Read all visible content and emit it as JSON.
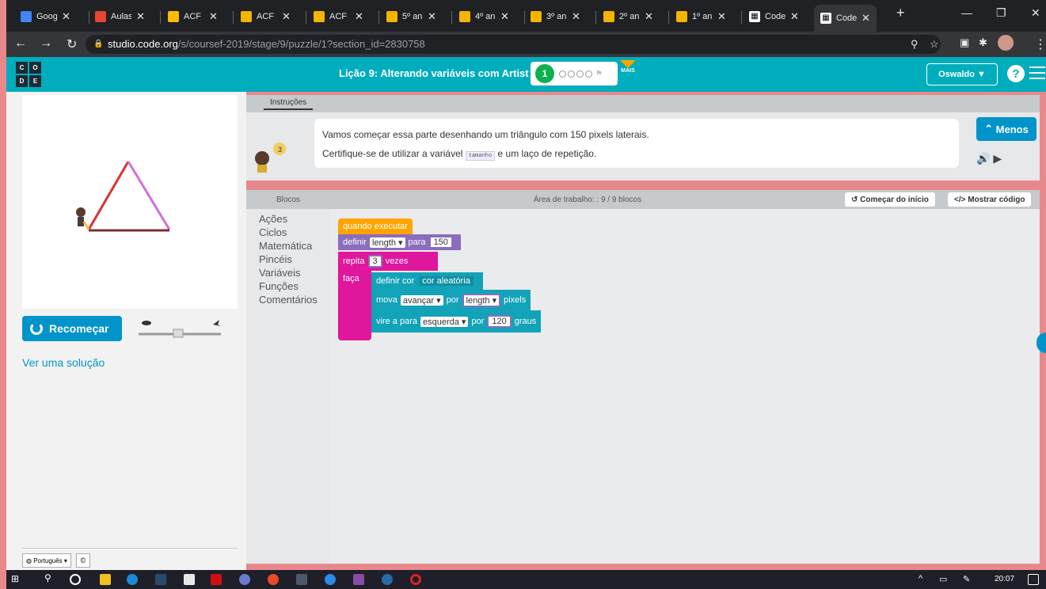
{
  "browser": {
    "tabs": [
      {
        "label": "Goog",
        "icon": "calendar-icon",
        "color": "#4285f4"
      },
      {
        "label": "Aulas",
        "icon": "gmail-icon",
        "color": "#ea4335"
      },
      {
        "label": "ACF II",
        "icon": "drive-icon",
        "color": "#fbbc04"
      },
      {
        "label": "ACF II",
        "icon": "slides-icon",
        "color": "#f4b400"
      },
      {
        "label": "ACF I",
        "icon": "slides-icon",
        "color": "#f4b400"
      },
      {
        "label": "5º an",
        "icon": "slides-icon",
        "color": "#f4b400"
      },
      {
        "label": "4º an",
        "icon": "slides-icon",
        "color": "#f4b400"
      },
      {
        "label": "3º an",
        "icon": "slides-icon",
        "color": "#f4b400"
      },
      {
        "label": "2º an",
        "icon": "slides-icon",
        "color": "#f4b400"
      },
      {
        "label": "1º an",
        "icon": "slides-icon",
        "color": "#f4b400"
      },
      {
        "label": "Code",
        "icon": "code-org-icon",
        "color": "#ffffff"
      },
      {
        "label": "Code",
        "icon": "code-org-icon",
        "color": "#ffffff"
      }
    ],
    "url_host": "studio.code.org",
    "url_path": "/s/coursef-2019/stage/9/puzzle/1?section_id=2830758"
  },
  "header": {
    "logo_letters": [
      "C",
      "O",
      "D",
      "E"
    ],
    "lesson_title": "Lição 9: Alterando variáveis com Artist",
    "progress_current": "1",
    "more_label": "MAIS",
    "user_name": "Oswaldo",
    "help": "?"
  },
  "left": {
    "reset_label": "Recomeçar",
    "solution_link": "Ver uma solução",
    "language": "Português",
    "copyright": "©"
  },
  "instructions": {
    "tab_label": "Instruções",
    "line1": "Vamos começar essa parte desenhando um triângulo com 150 pixels laterais.",
    "line2_pre": "Certifique-se de utilizar a variável",
    "line2_code": "tamanho",
    "line2_post": "e um laço de repetição.",
    "less_button": "Menos"
  },
  "workspace_header": {
    "blocks_label": "Blocos",
    "info": "Área de trabalho: : 9 / 9 blocos",
    "start_over": "Começar do início",
    "show_code": "Mostrar código"
  },
  "toolbox": [
    "Ações",
    "Ciclos",
    "Matemática",
    "Pincéis",
    "Variáveis",
    "Funções",
    "Comentários"
  ],
  "blocks": {
    "when_run": "quando executar",
    "set_kw": "definir",
    "set_var": "length",
    "set_to": "para",
    "set_value": "150",
    "repeat_kw": "repita",
    "repeat_count": "3",
    "repeat_times": "vezes",
    "do_kw": "faça",
    "set_color": "definir cor",
    "random_color": "cor aleatória",
    "move_kw": "mova",
    "move_dir": "avançar",
    "move_by": "por",
    "move_var": "length",
    "move_unit": "pixels",
    "turn_kw": "vire a",
    "turn_to": "para",
    "turn_dir": "esquerda",
    "turn_by": "por",
    "turn_value": "120",
    "turn_unit": "graus"
  },
  "taskbar": {
    "clock": "20:07"
  },
  "colors": {
    "codeorg_teal": "#00adbc",
    "button_blue": "#0094ca",
    "event_orange": "#ffa400",
    "variable_purple": "#8a6dbd",
    "loop_pink": "#e0169c",
    "brush_teal": "#12a3b8"
  }
}
